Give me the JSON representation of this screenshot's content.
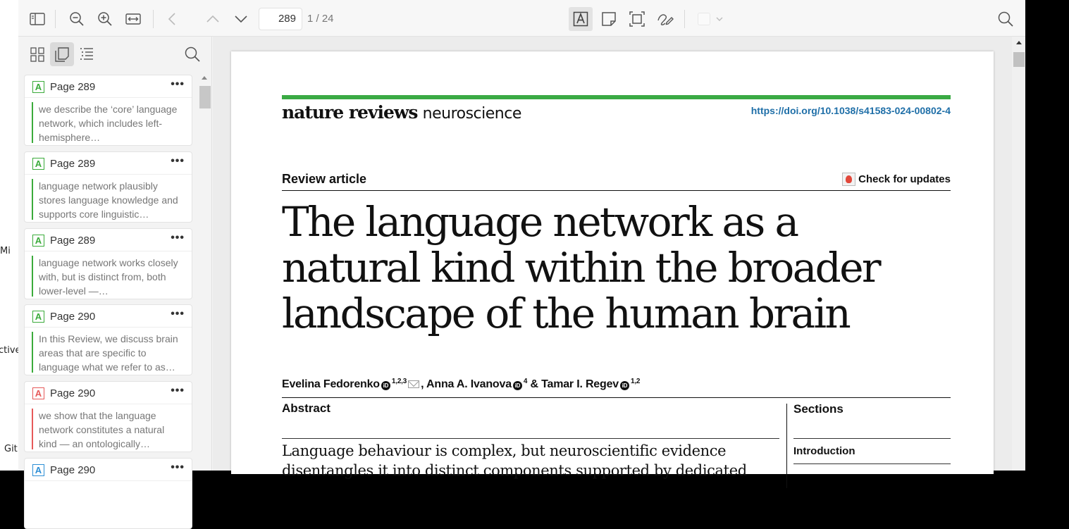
{
  "desktop": {
    "left_labels": [
      "Mi",
      "ctive",
      "Git"
    ]
  },
  "toolbar": {
    "page_number": "289",
    "page_total": "1 / 24"
  },
  "sidebar": {
    "annotations": [
      {
        "page": "Page 289",
        "color": "green",
        "icon": "A",
        "more": "•••",
        "text": "we describe the ‘core’ language network, which includes left-hemisphere…"
      },
      {
        "page": "Page 289",
        "color": "green",
        "icon": "A",
        "more": "•••",
        "text": "language network plausibly stores language knowledge and supports core linguistic…"
      },
      {
        "page": "Page 289",
        "color": "green",
        "icon": "A",
        "more": "•••",
        "text": "language network works closely with, but is distinct from, both lower-level —…"
      },
      {
        "page": "Page 290",
        "color": "green",
        "icon": "A",
        "more": "•••",
        "text": "In this Review, we discuss brain areas that are specific to language what we refer to as…"
      },
      {
        "page": "Page 290",
        "color": "red",
        "icon": "A",
        "more": "•••",
        "text": "we show that the language network constitutes a natural kind — an ontologically…"
      },
      {
        "page": "Page 290",
        "color": "blue",
        "icon": "A",
        "more": "•••",
        "text": ""
      }
    ]
  },
  "document": {
    "journal_bold": "nature reviews",
    "journal_light": "neuroscience",
    "doi": "https://doi.org/10.1038/s41583-024-00802-4",
    "article_type": "Review article",
    "check_updates": "Check for updates",
    "title": "The language network as a natural kind within the broader landscape of the human brain",
    "authors": {
      "a1": "Evelina Fedorenko",
      "a1_aff": "1,2,3",
      "a2": ", Anna A. Ivanova",
      "a2_aff": "4",
      "a3": " & Tamar I. Regev",
      "a3_aff": "1,2"
    },
    "orcid_label": "iD",
    "abstract_heading": "Abstract",
    "abstract_text": "Language behaviour is complex, but neuroscientific evidence disentangles it into distinct components supported by dedicated",
    "sections_heading": "Sections",
    "sections": [
      "Introduction"
    ]
  },
  "colors": {
    "green": "#3bab3b",
    "red": "#e65a5a",
    "blue": "#2d8fd6",
    "journal_bar": "#3aaa44",
    "doi_link": "#1f6fa8"
  }
}
